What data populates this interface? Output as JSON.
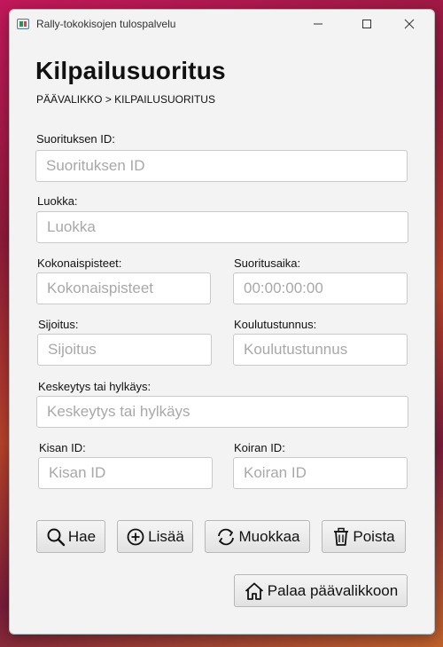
{
  "window": {
    "title": "Rally-tokokisojen tulospalvelu"
  },
  "page": {
    "heading": "Kilpailusuoritus",
    "breadcrumb": "PÄÄVALIKKO > KILPAILUSUORITUS"
  },
  "form": {
    "suoritus_id": {
      "label": "Suorituksen ID:",
      "placeholder": "Suorituksen ID",
      "value": ""
    },
    "luokka": {
      "label": "Luokka:",
      "placeholder": "Luokka",
      "value": ""
    },
    "kokonaispisteet": {
      "label": "Kokonaispisteet:",
      "placeholder": "Kokonaispisteet",
      "value": ""
    },
    "suoritusaika": {
      "label": "Suoritusaika:",
      "placeholder": "00:00:00:00",
      "value": ""
    },
    "sijoitus": {
      "label": "Sijoitus:",
      "placeholder": "Sijoitus",
      "value": ""
    },
    "koulutustunnus": {
      "label": "Koulutustunnus:",
      "placeholder": "Koulutustunnus",
      "value": ""
    },
    "keskeytys": {
      "label": "Keskeytys tai hylkäys:",
      "placeholder": "Keskeytys tai hylkäys",
      "value": ""
    },
    "kisan_id": {
      "label": "Kisan ID:",
      "placeholder": "Kisan ID",
      "value": ""
    },
    "koiran_id": {
      "label": "Koiran ID:",
      "placeholder": "Koiran ID",
      "value": ""
    }
  },
  "actions": {
    "search": {
      "label": "Hae",
      "icon": "search-icon"
    },
    "add": {
      "label": "Lisää",
      "icon": "plus-circle-icon"
    },
    "edit": {
      "label": "Muokkaa",
      "icon": "refresh-icon"
    },
    "delete": {
      "label": "Poista",
      "icon": "trash-icon"
    },
    "back": {
      "label": "Palaa päävalikkoon",
      "icon": "home-icon"
    }
  }
}
